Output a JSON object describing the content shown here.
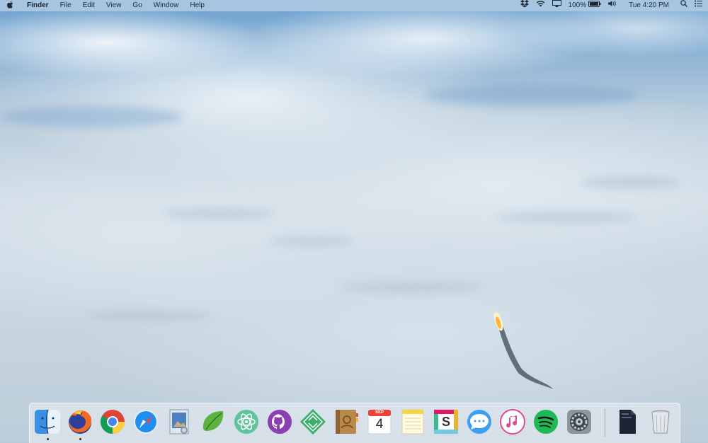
{
  "menubar": {
    "app_name": "Finder",
    "menus": [
      "File",
      "Edit",
      "View",
      "Go",
      "Window",
      "Help"
    ],
    "battery": "100%",
    "clock": "Tue 4:20 PM"
  },
  "dock": {
    "apps": [
      "finder",
      "firefox",
      "chrome",
      "safari",
      "preview",
      "evernote",
      "atom",
      "github-desktop",
      "sequel",
      "contacts",
      "calendar",
      "notes",
      "slack",
      "messages",
      "itunes",
      "spotify",
      "system-preferences",
      "downloads-folder",
      "trash"
    ],
    "calendar_month": "SEP",
    "calendar_day": "4",
    "slack_letter": "S"
  },
  "colors": {
    "menubar": "#aac8e1",
    "dock": "#e1e8ee",
    "sky": "#6fa2cf",
    "clouds": "#cfdbe5"
  }
}
